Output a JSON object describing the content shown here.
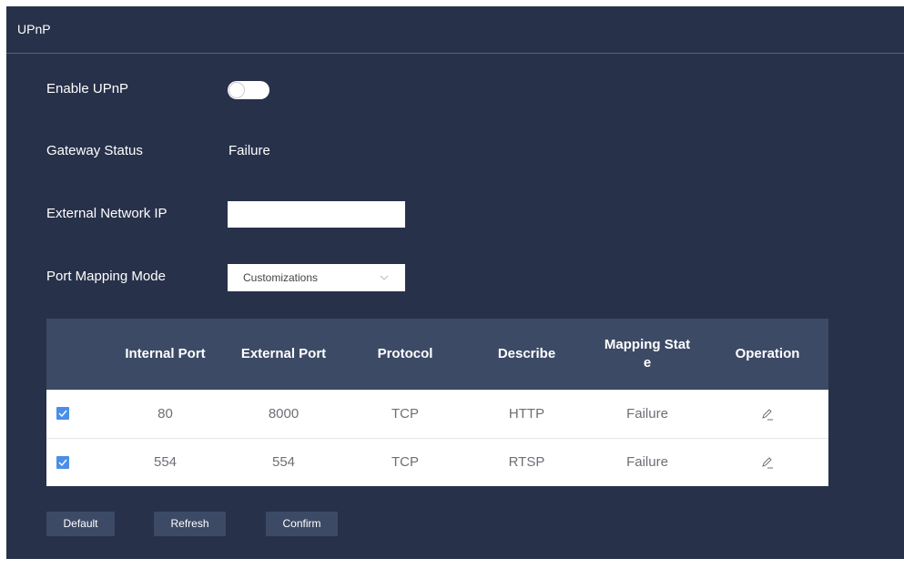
{
  "panel": {
    "title": "UPnP"
  },
  "form": {
    "enable_label": "Enable UPnP",
    "enable_value": false,
    "gateway_label": "Gateway Status",
    "gateway_value": "Failure",
    "external_ip_label": "External Network IP",
    "external_ip_value": "",
    "mapping_mode_label": "Port Mapping Mode",
    "mapping_mode_value": "Customizations"
  },
  "table": {
    "headers": {
      "internal_port": "Internal Port",
      "external_port": "External Port",
      "protocol": "Protocol",
      "describe": "Describe",
      "mapping_state_line1": "Mapping Stat",
      "mapping_state_line2": "e",
      "operation": "Operation"
    },
    "rows": [
      {
        "checked": true,
        "internal_port": "80",
        "external_port": "8000",
        "protocol": "TCP",
        "describe": "HTTP",
        "mapping_state": "Failure"
      },
      {
        "checked": true,
        "internal_port": "554",
        "external_port": "554",
        "protocol": "TCP",
        "describe": "RTSP",
        "mapping_state": "Failure"
      }
    ]
  },
  "buttons": {
    "default": "Default",
    "refresh": "Refresh",
    "confirm": "Confirm"
  },
  "icons": {
    "checkbox": "checkmark-icon",
    "edit": "pencil-edit-icon",
    "select": "chevron-down-icon"
  },
  "colors": {
    "panel_bg": "#27314a",
    "table_header_bg": "#3c4a66",
    "checkbox": "#4a8fe7",
    "button_bg": "#3c4a66"
  }
}
